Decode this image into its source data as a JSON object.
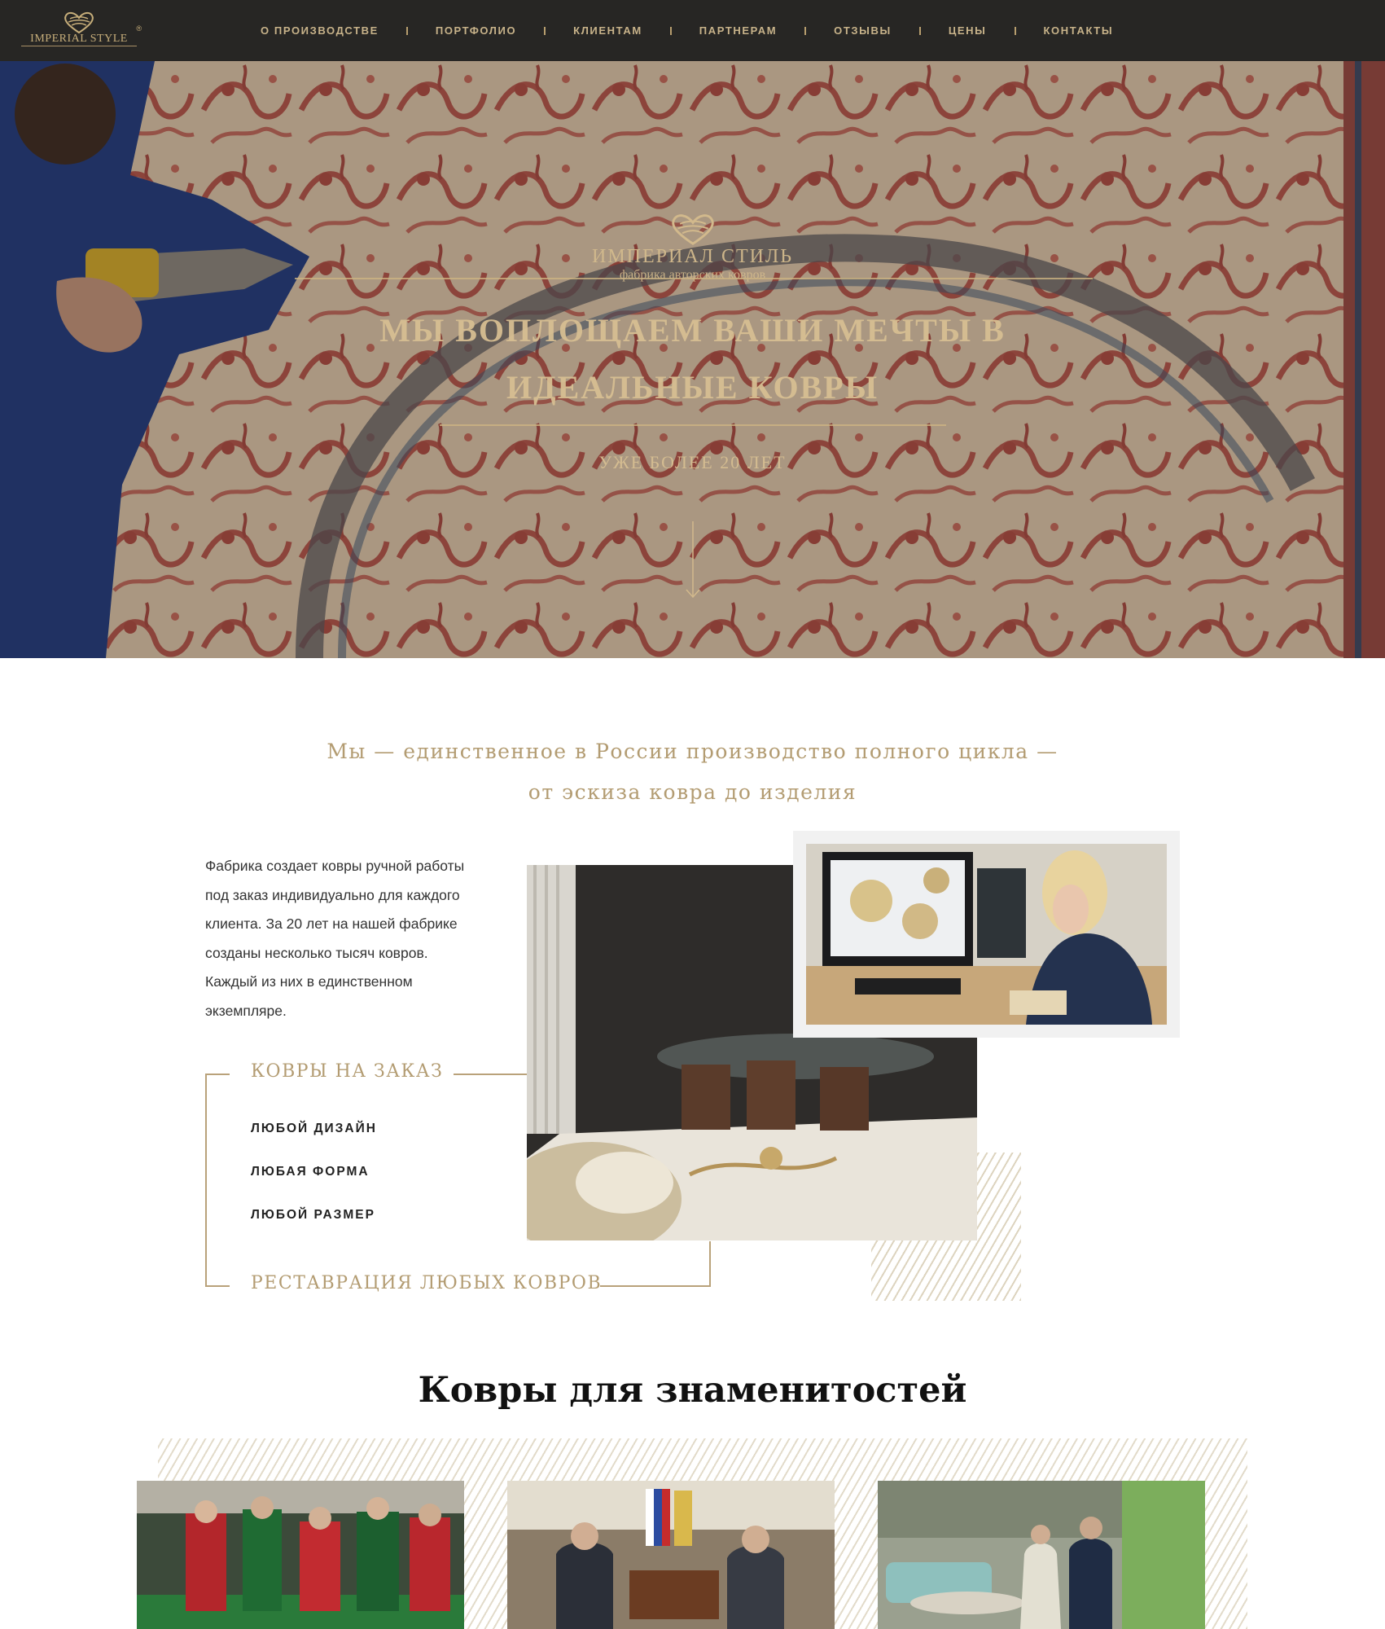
{
  "brand": {
    "logo_text": "IMPERIAL STYLE",
    "hero_name": "ИМПЕРИАЛ СТИЛЬ",
    "hero_tagline": "фабрика авторских ковров"
  },
  "nav": {
    "items": [
      {
        "label": "О ПРОИЗВОДСТВЕ"
      },
      {
        "label": "ПОРТФОЛИО"
      },
      {
        "label": "КЛИЕНТАМ"
      },
      {
        "label": "ПАРТНЕРАМ"
      },
      {
        "label": "ОТЗЫВЫ"
      },
      {
        "label": "ЦЕНЫ"
      },
      {
        "label": "КОНТАКТЫ"
      }
    ]
  },
  "hero": {
    "title_line1": "МЫ ВОПЛОЩАЕМ ВАШИ МЕЧТЫ В",
    "title_line2": "ИДЕАЛЬНЫЕ КОВРЫ",
    "subtitle": "УЖЕ БОЛЕЕ 20 ЛЕТ",
    "scroll_icon": "arrow-down-icon"
  },
  "about": {
    "intro_line1": "Мы — единственное в России производство полного цикла —",
    "intro_line2": "от эскиза ковра до изделия",
    "description_lines": [
      "Фабрика создает ковры ручной работы",
      "под заказ индивидуально для каждого",
      "клиента. За 20 лет на нашей фабрике",
      "созданы несколько тысяч ковров.",
      "Каждый из них в единственном",
      "экземпляре."
    ],
    "custom_heading": "КОВРЫ НА ЗАКАЗ",
    "features": [
      "ЛЮБОЙ ДИЗАЙН",
      "ЛЮБАЯ ФОРМА",
      "ЛЮБОЙ РАЗМЕР"
    ],
    "restoration_heading": "РЕСТАВРАЦИЯ ЛЮБЫХ КОВРОВ"
  },
  "celebrities": {
    "title": "Ковры для знаменитостей"
  },
  "colors": {
    "nav_bg": "#272624",
    "gold": "#b39c72",
    "nav_text": "#c8b38a"
  }
}
